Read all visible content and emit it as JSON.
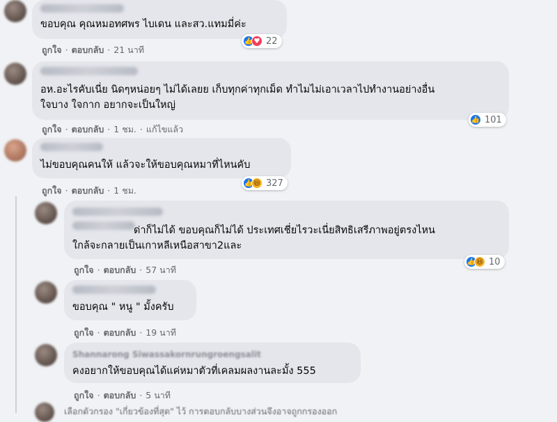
{
  "comments": [
    {
      "text_lines": [
        "ขอบคุณ คุณหมอทศพร ไบเดน และสว.แทมมี่ค่ะ"
      ],
      "like": "ถูกใจ",
      "reply": "ตอบกลับ",
      "time": "21 นาที",
      "edited": "",
      "reactions": [
        "like-icon",
        "love-icon"
      ],
      "reaction_count": "22"
    },
    {
      "text_lines": [
        "อห.อะไรคับเนี่ย นิดๆหน่อยๆ ไม่ได้เลยย เก็บทุกค่าทุกเม็ด ทำไมไม่เอาเวลาไปทำงานอย่างอื่น",
        "ใจบาง ใจกาก อยากจะเป็นใหญ่"
      ],
      "like": "ถูกใจ",
      "reply": "ตอบกลับ",
      "time": "1 ชม.",
      "edited": "แก้ไขแล้ว",
      "reactions": [
        "like-icon"
      ],
      "reaction_count": "101"
    },
    {
      "text_lines": [
        "ไม่ขอบคุณคนให้ แล้วจะให้ขอบคุณหมาที่ไหนคับ"
      ],
      "like": "ถูกใจ",
      "reply": "ตอบกลับ",
      "time": "1 ชม.",
      "edited": "",
      "reactions": [
        "like-icon",
        "haha-icon"
      ],
      "reaction_count": "327"
    }
  ],
  "replies": [
    {
      "text_lines": [
        "ด่าก็ไม่ได้ ขอบคุณก็ไม่ได้ ประเทศเชี่ยไรวะเนี่ยสิทธิเสรีภาพอยู่ตรงไหน",
        "ใกล้จะกลายเป็นเกาหลีเหนือสาขา2และ"
      ],
      "like": "ถูกใจ",
      "reply": "ตอบกลับ",
      "time": "57 นาที",
      "reactions": [
        "like-icon",
        "haha-icon"
      ],
      "reaction_count": "10"
    },
    {
      "text_lines": [
        "ขอบคุณ \" หนู \" มั้งครับ"
      ],
      "like": "ถูกใจ",
      "reply": "ตอบกลับ",
      "time": "19 นาที"
    },
    {
      "author": "Shannarong Siwassakornrungroengsalit",
      "text_lines": [
        "คงอยากให้ขอบคุณได้แค่หมาตัวที่เคลมผลงานละมั้ง 555"
      ],
      "like": "ถูกใจ",
      "reply": "ตอบกลับ",
      "time": "5 นาที"
    }
  ],
  "footer_note": "เลือกตัวกรอง \"เกี่ยวข้องที่สุด\" ไว้ การตอบกลับบางส่วนจึงอาจถูกกรองออก"
}
